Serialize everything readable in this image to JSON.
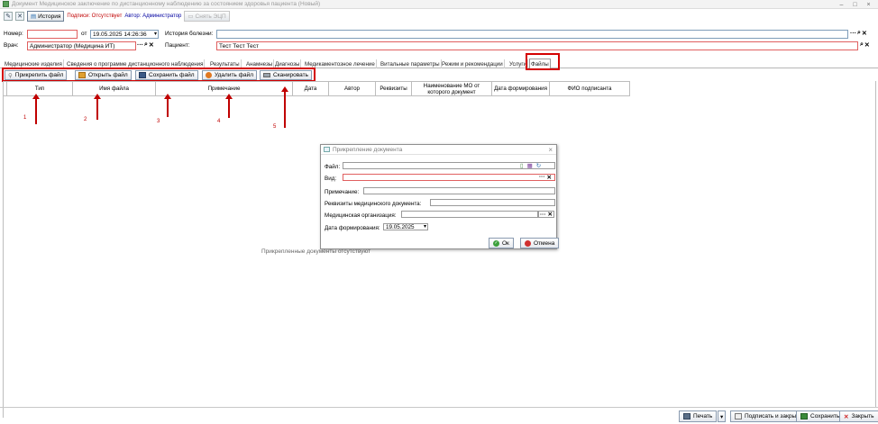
{
  "window": {
    "title": "Документ Медицинское заключение по дистанционному наблюдению за состоянием здоровья пациента (Новый)",
    "controls": [
      "–",
      "□",
      "×"
    ]
  },
  "toolbar": {
    "history_label": "История",
    "signatures_label": "Подписи: Отсутствует",
    "author_label": "Автор: Администратор",
    "remove_eds_label": "Снять ЭЦП"
  },
  "form": {
    "number_label": "Номер:",
    "number_value": "",
    "from_label": "от",
    "date_value": "19.05.2025 14:26:36",
    "history_label": "История болезни:",
    "history_value": "",
    "doctor_label": "Врач:",
    "doctor_value": "Администратор (Медицина ИТ)",
    "patient_label": "Пациент:",
    "patient_value": "Тест Тест Тест"
  },
  "tabs": [
    "Медицинские изделия",
    "Сведения о программе дистанционного наблюдения",
    "Результаты",
    "Анамнезы",
    "Диагнозы",
    "Медикаментозное лечение",
    "Витальные параметры",
    "Режим и рекомендации",
    "Услуги",
    "Файлы"
  ],
  "actions": {
    "attach": "Прикрепить файл",
    "open": "Открыть файл",
    "save": "Сохранить файл",
    "delete": "Удалить файл",
    "scan": "Сканировать"
  },
  "grid_columns": [
    "Тип",
    "Имя файла",
    "Примечание",
    "Дата",
    "Автор",
    "Реквизиты",
    "Наименование МО от которого документ",
    "Дата формирования",
    "ФИО подписанта"
  ],
  "empty_text": "Прикрепленные документы отсутствуют",
  "annotations": [
    "1",
    "2",
    "3",
    "4",
    "5"
  ],
  "dialog": {
    "title": "Прикрепление документа",
    "file_label": "Файл:",
    "file_value": "",
    "kind_label": "Вид:",
    "kind_value": "",
    "note_label": "Примечание:",
    "note_value": "",
    "requisites_label": "Реквизиты медицинского документа:",
    "requisites_value": "",
    "org_label": "Медицинская организация:",
    "org_value": "",
    "date_label": "Дата формирования:",
    "date_value": "19.05.2025",
    "ok_label": "Ок",
    "cancel_label": "Отмена"
  },
  "bottom": {
    "print": "Печать",
    "sign_close": "Подписать и закрыть",
    "save": "Сохранить",
    "close": "Закрыть"
  },
  "colors": {
    "highlight": "#d40000",
    "required_border": "#e06060",
    "field_border": "#7f9db9"
  }
}
